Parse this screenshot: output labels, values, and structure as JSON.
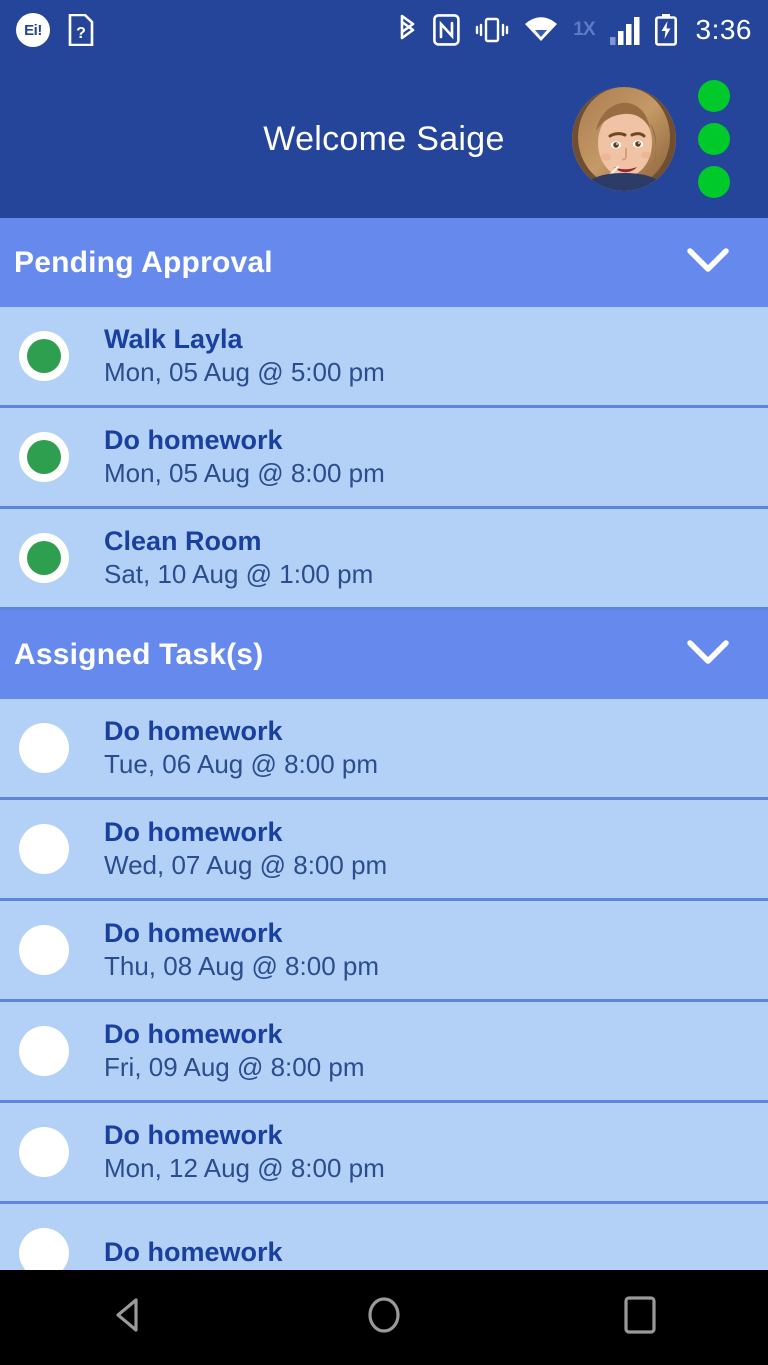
{
  "statusbar": {
    "left_icons": [
      "ei-alert-icon",
      "sim-question-icon"
    ],
    "ei_label": "Ei!",
    "sim_label": "?",
    "right_icons": [
      "bluetooth-icon",
      "nfc-icon",
      "vibrate-icon",
      "wifi-icon",
      "signal-bars-icon",
      "battery-charging-icon"
    ],
    "network_label": "1X",
    "time": "3:36"
  },
  "appbar": {
    "title": "Welcome Saige",
    "avatar_alt": "user-avatar-photo",
    "overflow_dots": 3
  },
  "sections": [
    {
      "title": "Pending Approval",
      "expanded": true,
      "chevron": "chevron-down-icon",
      "items": [
        {
          "title": "Walk Layla",
          "due": "Mon, 05 Aug @ 5:00 pm",
          "status": "approved"
        },
        {
          "title": "Do homework",
          "due": "Mon, 05 Aug @ 8:00 pm",
          "status": "approved"
        },
        {
          "title": "Clean Room",
          "due": "Sat, 10 Aug @ 1:00 pm",
          "status": "approved"
        }
      ]
    },
    {
      "title": "Assigned Task(s)",
      "expanded": true,
      "chevron": "chevron-down-icon",
      "items": [
        {
          "title": "Do homework",
          "due": "Tue, 06 Aug @ 8:00 pm",
          "status": "pending"
        },
        {
          "title": "Do homework",
          "due": "Wed, 07 Aug @ 8:00 pm",
          "status": "pending"
        },
        {
          "title": "Do homework",
          "due": "Thu, 08 Aug @ 8:00 pm",
          "status": "pending"
        },
        {
          "title": "Do homework",
          "due": "Fri, 09 Aug @ 8:00 pm",
          "status": "pending"
        },
        {
          "title": "Do homework",
          "due": "Mon, 12 Aug @ 8:00 pm",
          "status": "pending"
        },
        {
          "title": "Do homework",
          "due": "",
          "status": "pending"
        }
      ]
    }
  ],
  "navbar": {
    "back": "back-triangle-icon",
    "home": "home-circle-icon",
    "recents": "recents-square-icon"
  },
  "colors": {
    "header_blue": "#24459A",
    "section_blue": "#6589EC",
    "row_blue": "#B3D1F7",
    "divider_blue": "#5C86DC",
    "green_dot": "#00C92B",
    "green_status": "#2E9E4F",
    "title_text": "#19409E",
    "sub_text": "#2B4D8E"
  }
}
